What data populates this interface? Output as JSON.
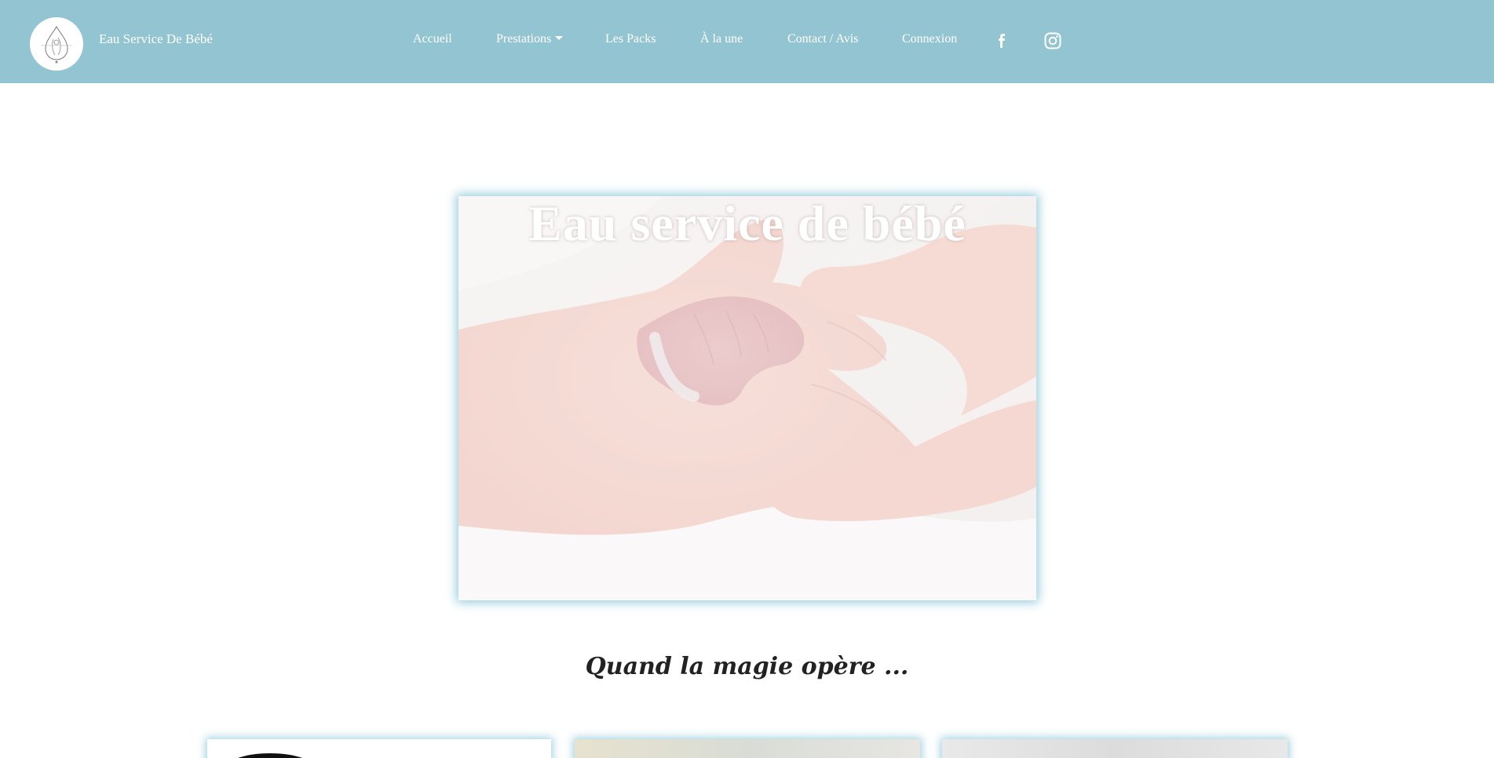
{
  "navbar": {
    "brand_name": "Eau Service De Bébé",
    "links": [
      {
        "label": "Accueil"
      },
      {
        "label": "Prestations",
        "dropdown": true
      },
      {
        "label": "Les Packs"
      },
      {
        "label": "À la une"
      },
      {
        "label": "Contact / Avis"
      },
      {
        "label": "Connexion"
      }
    ],
    "social_icons": [
      "facebook-icon",
      "instagram-icon"
    ],
    "background_color": "#93c4d1"
  },
  "hero": {
    "title": "Eau service de bébé"
  },
  "section": {
    "heading": "Quand la magie opère ..."
  }
}
